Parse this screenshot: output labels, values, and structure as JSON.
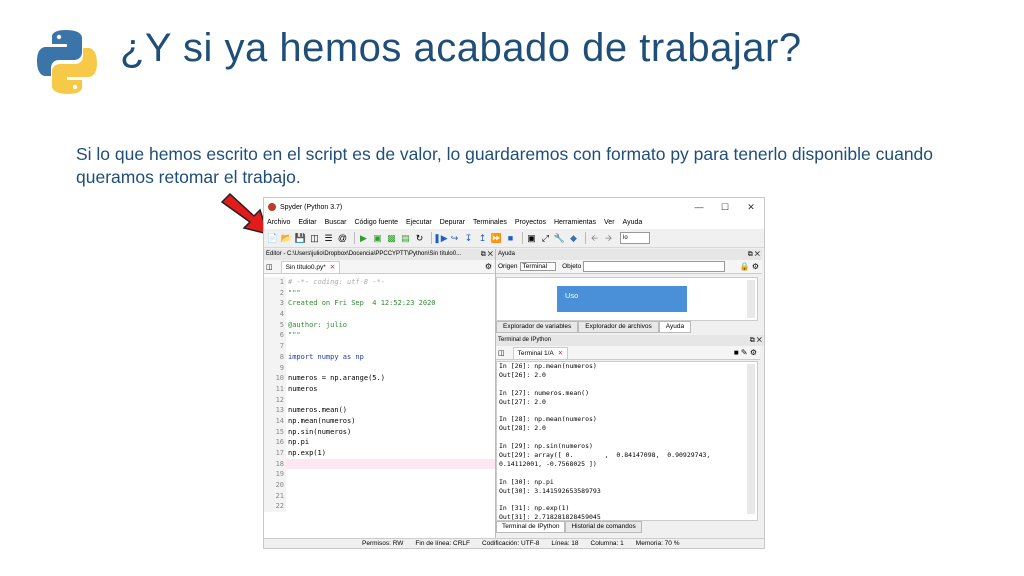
{
  "slide": {
    "title": "¿Y si ya hemos acabado de trabajar?",
    "text": "Si lo que hemos escrito en el script es de valor, lo guardaremos con formato py para tenerlo disponible cuando queramos retomar el trabajo."
  },
  "window": {
    "title": "Spyder (Python 3.7)",
    "menu": [
      "Archivo",
      "Editar",
      "Buscar",
      "Código fuente",
      "Ejecutar",
      "Depurar",
      "Terminales",
      "Proyectos",
      "Herramientas",
      "Ver",
      "Ayuda"
    ],
    "toolbar_combo": "lo"
  },
  "editor": {
    "header": "Editor - C:\\Users\\julio\\Dropbox\\Docencia\\PPCCYPTT\\Python\\Sin título0...",
    "tab": "Sin título0.py*",
    "lines": [
      {
        "n": "1",
        "t": "# -*- coding: utf-8 -*-",
        "c": "cm"
      },
      {
        "n": "2",
        "t": "\"\"\"",
        "c": "st"
      },
      {
        "n": "3",
        "t": "Created on Fri Sep  4 12:52:23 2020",
        "c": "st"
      },
      {
        "n": "4",
        "t": "",
        "c": "st"
      },
      {
        "n": "5",
        "t": "@author: julio",
        "c": "st"
      },
      {
        "n": "6",
        "t": "\"\"\"",
        "c": "st"
      },
      {
        "n": "7",
        "t": "",
        "c": ""
      },
      {
        "n": "8",
        "t": "import numpy as np",
        "c": "kw"
      },
      {
        "n": "9",
        "t": "",
        "c": ""
      },
      {
        "n": "10",
        "t": "numeros = np.arange(5.)",
        "c": ""
      },
      {
        "n": "11",
        "t": "numeros",
        "c": ""
      },
      {
        "n": "12",
        "t": "",
        "c": ""
      },
      {
        "n": "13",
        "t": "numeros.mean()",
        "c": ""
      },
      {
        "n": "14",
        "t": "np.mean(numeros)",
        "c": ""
      },
      {
        "n": "15",
        "t": "np.sin(numeros)",
        "c": ""
      },
      {
        "n": "16",
        "t": "np.pi",
        "c": ""
      },
      {
        "n": "17",
        "t": "np.exp(1)",
        "c": ""
      },
      {
        "n": "18",
        "t": "",
        "c": "hl"
      },
      {
        "n": "19",
        "t": "",
        "c": ""
      },
      {
        "n": "20",
        "t": "",
        "c": ""
      },
      {
        "n": "21",
        "t": "",
        "c": ""
      },
      {
        "n": "22",
        "t": "",
        "c": ""
      }
    ]
  },
  "help": {
    "header": "Ayuda",
    "origen_label": "Origen",
    "origen_value": "Terminal",
    "objeto_label": "Objeto",
    "uso": "Uso",
    "tabs": [
      "Explorador de variables",
      "Explorador de archivos",
      "Ayuda"
    ]
  },
  "console": {
    "header": "Terminal de IPython",
    "tab": "Terminal 1/A",
    "lines": [
      "In [26]: np.mean(numeros)",
      "Out[26]: 2.0",
      "",
      "In [27]: numeros.mean()",
      "Out[27]: 2.0",
      "",
      "In [28]: np.mean(numeros)",
      "Out[28]: 2.0",
      "",
      "In [29]: np.sin(numeros)",
      "Out[29]: array([ 0.        ,  0.84147098,  0.90929743,",
      "0.14112001, -0.7568025 ])",
      "",
      "In [30]: np.pi",
      "Out[30]: 3.141592653589793",
      "",
      "In [31]: np.exp(1)",
      "Out[31]: 2.718281828459045"
    ],
    "tabs": [
      "Terminal de IPython",
      "Historial de comandos"
    ]
  },
  "status": {
    "permisos": "Permisos:  RW",
    "fin": "Fin de línea:  CRLF",
    "cod": "Codificación:  UTF-8",
    "linea": "Línea:  18",
    "columna": "Columna:  1",
    "memoria": "Memoria:  70 %"
  }
}
